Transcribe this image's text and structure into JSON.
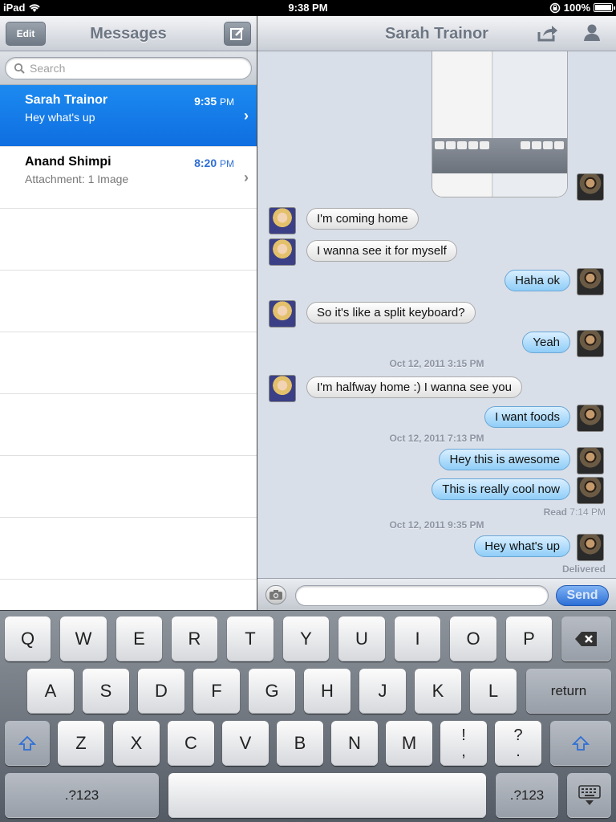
{
  "status_bar": {
    "device": "iPad",
    "time": "9:38 PM",
    "battery": "100%",
    "battery_level": 1.0
  },
  "sidebar": {
    "title": "Messages",
    "edit_label": "Edit",
    "search_placeholder": "Search",
    "conversations": [
      {
        "name": "Sarah Trainor",
        "time": "9:35",
        "ampm": "PM",
        "preview": "Hey what's up",
        "selected": true
      },
      {
        "name": "Anand Shimpi",
        "time": "8:20",
        "ampm": "PM",
        "preview": "Attachment: 1 Image",
        "selected": false
      }
    ]
  },
  "chat": {
    "title": "Sarah Trainor",
    "messages": [
      {
        "text": "I'm coming home",
        "dir": "in"
      },
      {
        "text": "I wanna see it for myself",
        "dir": "in"
      },
      {
        "text": "Haha ok",
        "dir": "out"
      },
      {
        "text": "So it's like a split keyboard?",
        "dir": "in"
      },
      {
        "text": "Yeah",
        "dir": "out"
      },
      {
        "text": "I'm halfway home :) I wanna see you",
        "dir": "in"
      },
      {
        "text": "I want foods",
        "dir": "out"
      },
      {
        "text": "Hey this is awesome",
        "dir": "out"
      },
      {
        "text": "This is really cool now",
        "dir": "out"
      },
      {
        "text": "Hey what's up",
        "dir": "out"
      }
    ],
    "timestamps": [
      "Oct 12, 2011 3:15 PM",
      "Oct 12, 2011 7:13 PM",
      "Oct 12, 2011 9:35 PM"
    ],
    "read_label": "Read",
    "read_time": "7:14 PM",
    "delivered_label": "Delivered",
    "send_label": "Send"
  },
  "keyboard": {
    "row1": [
      "Q",
      "W",
      "E",
      "R",
      "T",
      "Y",
      "U",
      "I",
      "O",
      "P"
    ],
    "row2": [
      "A",
      "S",
      "D",
      "F",
      "G",
      "H",
      "J",
      "K",
      "L"
    ],
    "row3": [
      "Z",
      "X",
      "C",
      "V",
      "B",
      "N",
      "M"
    ],
    "punct1_top": "!",
    "punct1_bottom": ",",
    "punct2_top": "?",
    "punct2_bottom": ".",
    "return_label": "return",
    "numbers_label": ".?123"
  },
  "colors": {
    "selection_blue": "#1a84ec",
    "outgoing_bubble": "#a9d9fb",
    "send_blue": "#2c6fd6"
  }
}
